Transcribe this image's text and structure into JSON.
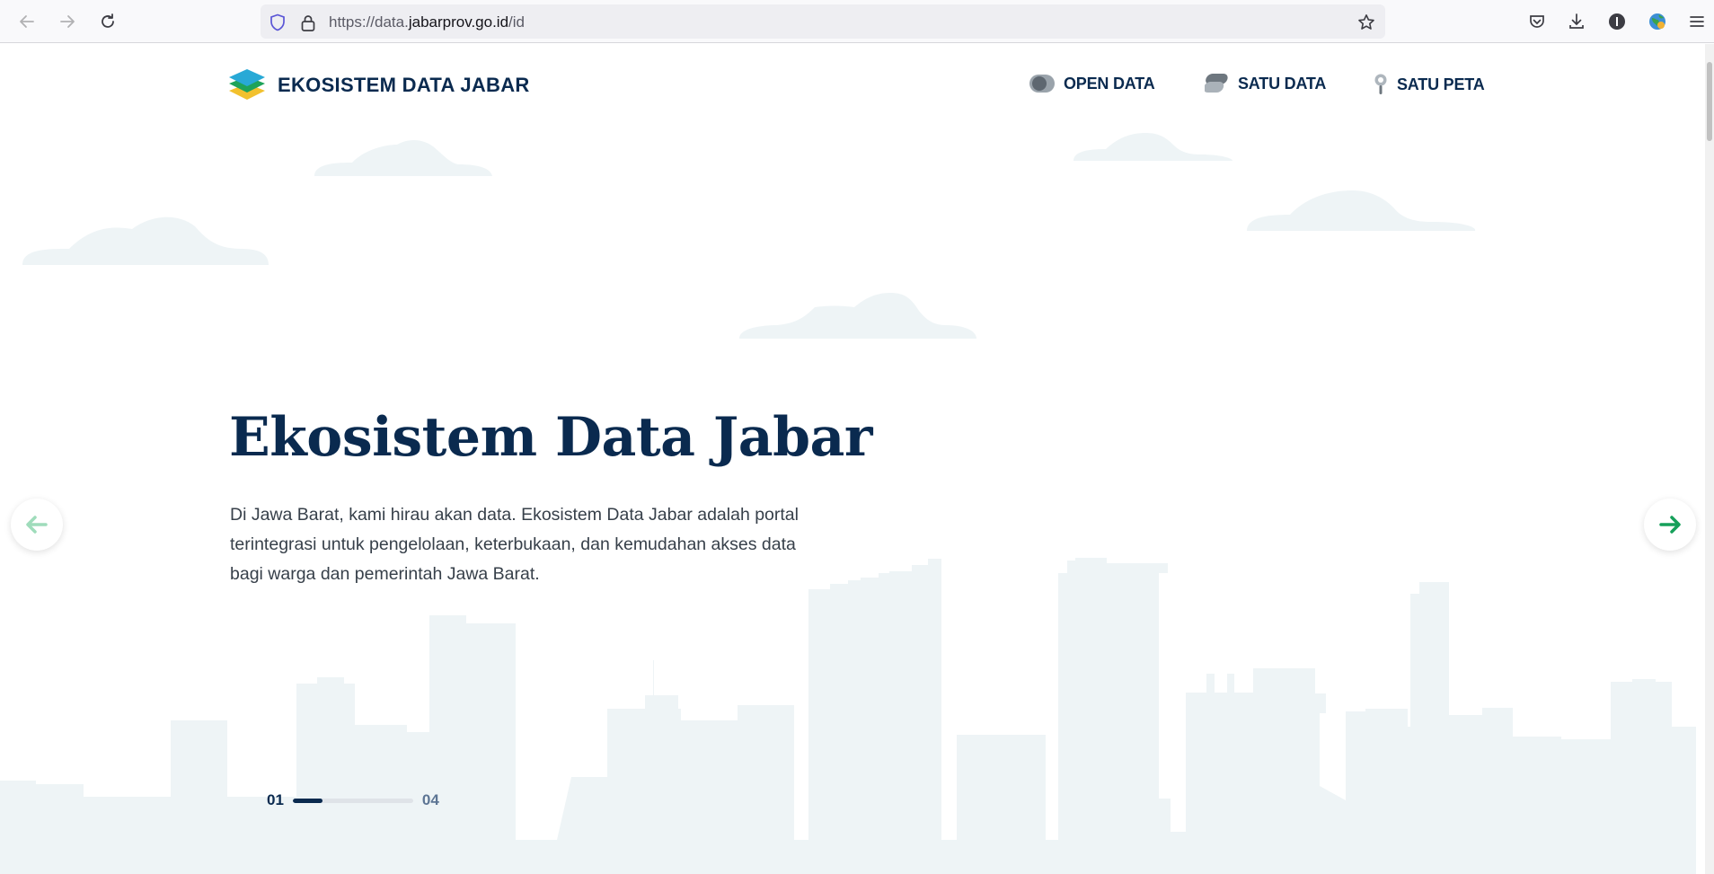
{
  "browser": {
    "url_prefix": "https://data.",
    "url_domain": "jabarprov.go.id",
    "url_suffix": "/id"
  },
  "site": {
    "logo_text": "EKOSISTEM DATA JABAR",
    "nav": [
      {
        "label": "OPEN DATA",
        "icon": "open-data-icon"
      },
      {
        "label": "SATU DATA",
        "icon": "satu-data-icon"
      },
      {
        "label": "SATU PETA",
        "icon": "satu-peta-icon"
      }
    ]
  },
  "hero": {
    "title": "Ekosistem Data Jabar",
    "description": "Di Jawa Barat, kami hirau akan data. Ekosistem Data Jabar adalah portal terintegrasi untuk pengelolaan, keterbukaan, dan kemudahan akses data bagi warga dan pemerintah Jawa Barat."
  },
  "slider": {
    "current": "01",
    "total": "04",
    "progress": 0.25
  },
  "colors": {
    "brand_navy": "#0a2a4f",
    "accent_green": "#16a05a",
    "skyline": "#eef4f6"
  }
}
